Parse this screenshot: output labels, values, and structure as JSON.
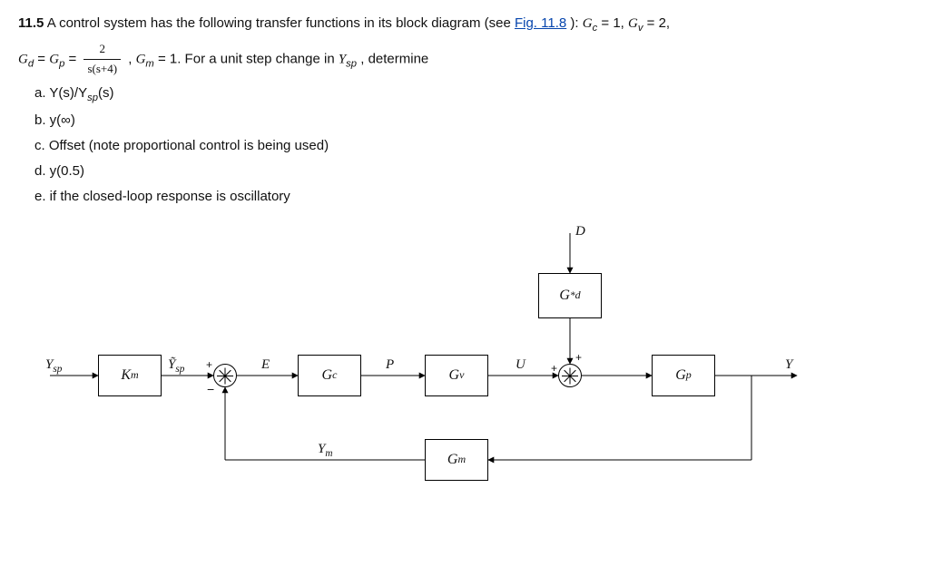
{
  "problem": {
    "number": "11.5",
    "intro_pre": "A control system has the following transfer functions in its block diagram (see ",
    "fig_link": "Fig. 11.8",
    "intro_post": "): ",
    "Gc": "G",
    "Gc_sub": "c",
    "Gc_eq": " = 1, ",
    "Gv": "G",
    "Gv_sub": "v",
    "Gv_eq": " = 2,",
    "line2_a": "G",
    "line2_a_sub": "d",
    "line2_eq1": " = ",
    "line2_b": "G",
    "line2_b_sub": "p",
    "line2_eq2": " = ",
    "frac_num": "2",
    "frac_den": "s(s+4)",
    "line2_c": ", ",
    "line2_d": "G",
    "line2_d_sub": "m",
    "line2_e": " = 1. For a unit step change in ",
    "line2_f": "Y",
    "line2_f_sub": "sp",
    "line2_g": ", determine",
    "parts": {
      "a": "a. Y(s)/Y",
      "a_sub": "sp",
      "a_post": "(s)",
      "b": "b. y(∞)",
      "c": "c. Offset (note proportional control is being used)",
      "d": "d. y(0.5)",
      "e": "e. if the closed-loop response is oscillatory"
    }
  },
  "diagram": {
    "blocks": {
      "Km": "K",
      "Km_sub": "m",
      "Gc": "G",
      "Gc_sub": "c",
      "Gv": "G",
      "Gv_sub": "v",
      "Gp": "G",
      "Gp_sub": "p",
      "Gm": "G",
      "Gm_sub": "m",
      "Gd": "G",
      "Gd_sub": "d",
      "Gd_sup": "*"
    },
    "signals": {
      "Ysp": "Y",
      "Ysp_sub": "sp",
      "Ysp_t": "Ỹ",
      "Ysp_t_sub": "sp",
      "E": "E",
      "P": "P",
      "U": "U",
      "D": "D",
      "Y": "Y",
      "Ym": "Y",
      "Ym_sub": "m"
    }
  }
}
